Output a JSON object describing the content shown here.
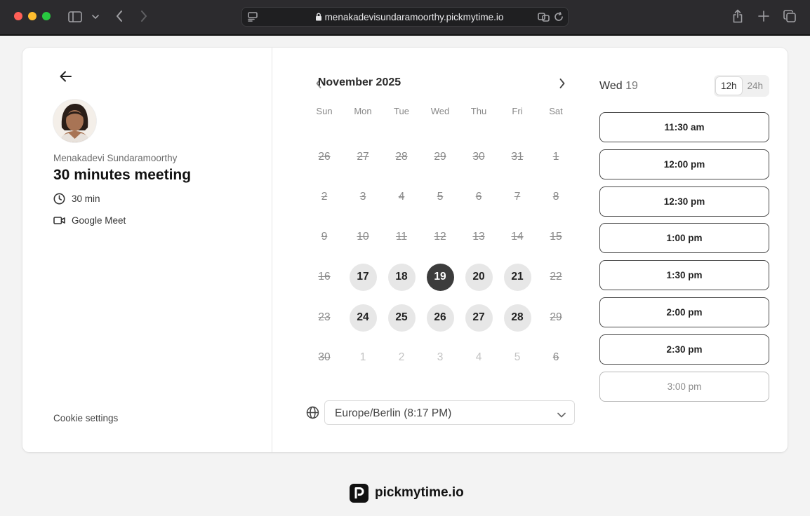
{
  "browser": {
    "url": "menakadevisundaramoorthy.pickmytime.io",
    "icons": [
      "sidebar-icon",
      "chevron-down-icon",
      "back-arrow-icon",
      "forward-arrow-icon",
      "reader-icon",
      "lock-icon",
      "translate-icon",
      "reload-icon",
      "share-icon",
      "new-tab-icon",
      "tabs-overview-icon"
    ]
  },
  "event": {
    "host_name": "Menakadevi Sundaramoorthy",
    "title": "30 minutes meeting",
    "duration": "30 min",
    "location": "Google Meet",
    "cookie_settings": "Cookie settings"
  },
  "calendar": {
    "month_label": "November 2025",
    "weekdays": [
      "Sun",
      "Mon",
      "Tue",
      "Wed",
      "Thu",
      "Fri",
      "Sat"
    ],
    "weeks": [
      [
        {
          "d": "26",
          "s": "prev"
        },
        {
          "d": "27",
          "s": "prev"
        },
        {
          "d": "28",
          "s": "prev"
        },
        {
          "d": "29",
          "s": "prev"
        },
        {
          "d": "30",
          "s": "prev"
        },
        {
          "d": "31",
          "s": "prev"
        },
        {
          "d": "1",
          "s": "disabled"
        }
      ],
      [
        {
          "d": "2",
          "s": "disabled"
        },
        {
          "d": "3",
          "s": "disabled"
        },
        {
          "d": "4",
          "s": "disabled"
        },
        {
          "d": "5",
          "s": "disabled"
        },
        {
          "d": "6",
          "s": "disabled"
        },
        {
          "d": "7",
          "s": "disabled"
        },
        {
          "d": "8",
          "s": "disabled"
        }
      ],
      [
        {
          "d": "9",
          "s": "disabled"
        },
        {
          "d": "10",
          "s": "disabled"
        },
        {
          "d": "11",
          "s": "disabled"
        },
        {
          "d": "12",
          "s": "disabled"
        },
        {
          "d": "13",
          "s": "disabled"
        },
        {
          "d": "14",
          "s": "disabled"
        },
        {
          "d": "15",
          "s": "disabled"
        }
      ],
      [
        {
          "d": "16",
          "s": "disabled"
        },
        {
          "d": "17",
          "s": "available"
        },
        {
          "d": "18",
          "s": "available"
        },
        {
          "d": "19",
          "s": "selected"
        },
        {
          "d": "20",
          "s": "available"
        },
        {
          "d": "21",
          "s": "available"
        },
        {
          "d": "22",
          "s": "disabled"
        }
      ],
      [
        {
          "d": "23",
          "s": "disabled"
        },
        {
          "d": "24",
          "s": "available"
        },
        {
          "d": "25",
          "s": "available"
        },
        {
          "d": "26",
          "s": "available"
        },
        {
          "d": "27",
          "s": "available"
        },
        {
          "d": "28",
          "s": "available"
        },
        {
          "d": "29",
          "s": "disabled"
        }
      ],
      [
        {
          "d": "30",
          "s": "disabled"
        },
        {
          "d": "1",
          "s": "next"
        },
        {
          "d": "2",
          "s": "next"
        },
        {
          "d": "3",
          "s": "next"
        },
        {
          "d": "4",
          "s": "next"
        },
        {
          "d": "5",
          "s": "next"
        },
        {
          "d": "6",
          "s": "next-disabled"
        }
      ]
    ],
    "timezone": "Europe/Berlin (8:17 PM)"
  },
  "slots": {
    "day_label": "Wed",
    "day_number": "19",
    "format_options": [
      "12h",
      "24h"
    ],
    "active_format": "12h",
    "times": [
      "11:30 am",
      "12:00 pm",
      "12:30 pm",
      "1:00 pm",
      "1:30 pm",
      "2:00 pm",
      "2:30 pm",
      "3:00 pm"
    ]
  },
  "footer": {
    "brand": "pickmytime.io"
  },
  "colors": {
    "selected_day": "#3c3c3c",
    "available_day": "#e7e7e7",
    "page_background": "#f3f3f3"
  }
}
